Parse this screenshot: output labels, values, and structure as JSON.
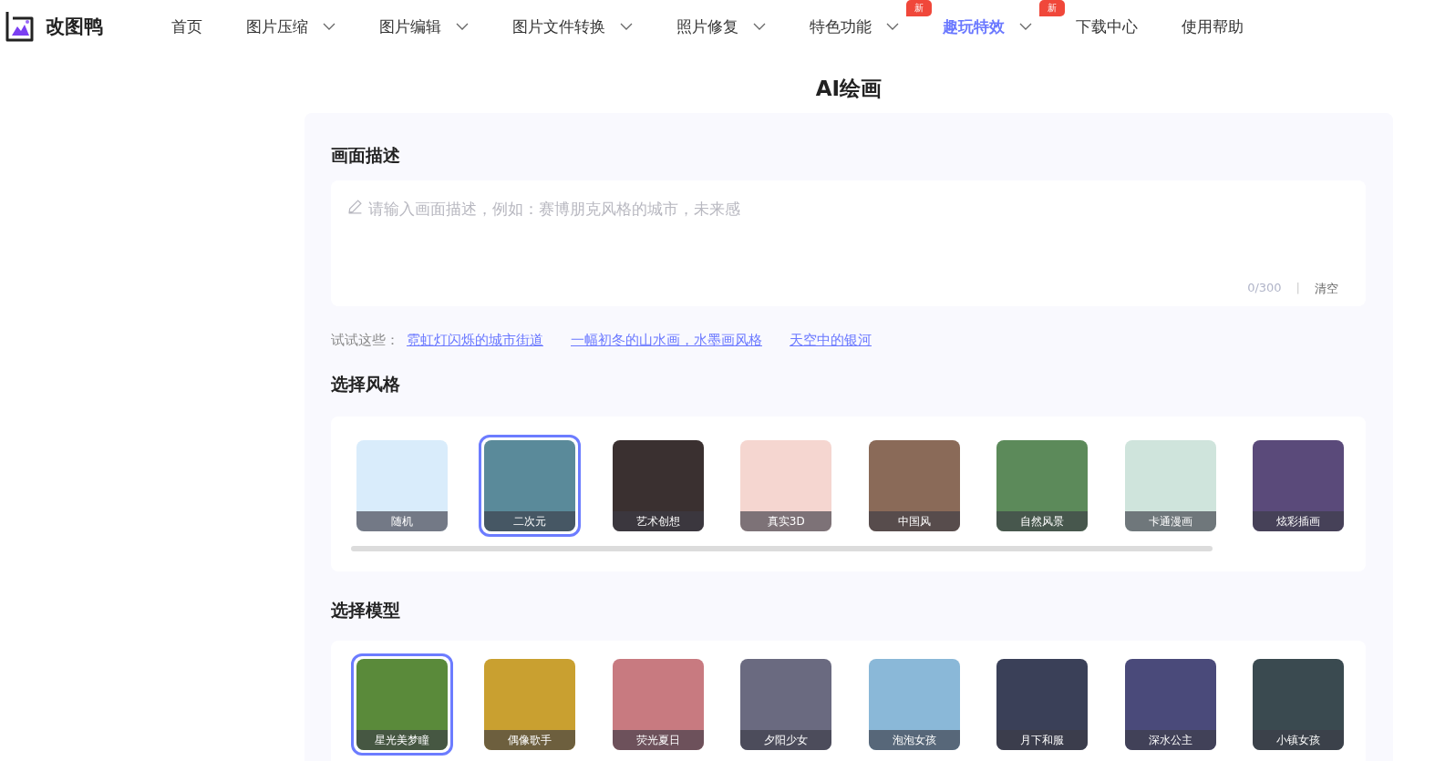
{
  "logo": {
    "text": "改图鸭"
  },
  "nav": [
    {
      "label": "首页",
      "dropdown": false,
      "selected": false
    },
    {
      "label": "图片压缩",
      "dropdown": true,
      "selected": false
    },
    {
      "label": "图片编辑",
      "dropdown": true,
      "selected": false
    },
    {
      "label": "图片文件转换",
      "dropdown": true,
      "selected": false
    },
    {
      "label": "照片修复",
      "dropdown": true,
      "selected": false
    },
    {
      "label": "特色功能",
      "dropdown": true,
      "selected": false,
      "badge": "新"
    },
    {
      "label": "趣玩特效",
      "dropdown": true,
      "selected": true,
      "badge": "新"
    },
    {
      "label": "下载中心",
      "dropdown": false,
      "selected": false
    },
    {
      "label": "使用帮助",
      "dropdown": false,
      "selected": false
    }
  ],
  "page_title": "AI绘画",
  "description": {
    "heading": "画面描述",
    "placeholder": "请输入画面描述，例如：赛博朋克风格的城市，未来感",
    "counter": "0/300",
    "separator": "|",
    "clear": "清空"
  },
  "suggestions": {
    "label": "试试这些：",
    "items": [
      "霓虹灯闪烁的城市街道",
      "一幅初冬的山水画，水墨画风格",
      "天空中的银河"
    ]
  },
  "styles": {
    "heading": "选择风格",
    "items": [
      {
        "label": "随机",
        "selected": false
      },
      {
        "label": "二次元",
        "selected": true
      },
      {
        "label": "艺术创想",
        "selected": false
      },
      {
        "label": "真实3D",
        "selected": false
      },
      {
        "label": "中国风",
        "selected": false
      },
      {
        "label": "自然风景",
        "selected": false
      },
      {
        "label": "卡通漫画",
        "selected": false
      },
      {
        "label": "炫彩插画",
        "selected": false
      }
    ]
  },
  "models": {
    "heading": "选择模型",
    "items": [
      {
        "label": "星光美梦瞳",
        "selected": true
      },
      {
        "label": "偶像歌手",
        "selected": false
      },
      {
        "label": "荧光夏日",
        "selected": false
      },
      {
        "label": "夕阳少女",
        "selected": false
      },
      {
        "label": "泡泡女孩",
        "selected": false
      },
      {
        "label": "月下和服",
        "selected": false
      },
      {
        "label": "深水公主",
        "selected": false
      },
      {
        "label": "小镇女孩",
        "selected": false
      }
    ]
  }
}
